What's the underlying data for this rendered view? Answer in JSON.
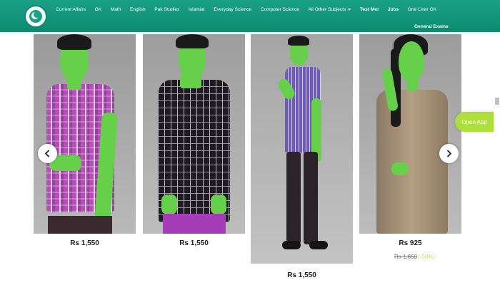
{
  "header": {
    "nav": [
      {
        "label": "Current Affairs",
        "bold": false
      },
      {
        "label": "GK",
        "bold": false
      },
      {
        "label": "Math",
        "bold": false
      },
      {
        "label": "English",
        "bold": false
      },
      {
        "label": "Pak Studies",
        "bold": false
      },
      {
        "label": "Islamiat",
        "bold": false
      },
      {
        "label": "Everyday Science",
        "bold": false
      },
      {
        "label": "Computer Science",
        "bold": false
      },
      {
        "label": "All Other Subjects",
        "bold": false
      },
      {
        "label": "Test Me!",
        "bold": true
      },
      {
        "label": "Jobs",
        "bold": true
      },
      {
        "label": "One Liner GK",
        "bold": false
      }
    ],
    "nav_second": "General Exams"
  },
  "products": [
    {
      "price": "Rs 1,550"
    },
    {
      "price": "Rs 1,550"
    },
    {
      "price": "Rs 1,550"
    },
    {
      "price": "Rs 925",
      "old_price": "Rs 1,850",
      "discount": "(-50%)"
    }
  ],
  "open_app_label": "Open App",
  "colors": {
    "header_bg": "#1aa286",
    "open_app_bg": "#aede3c",
    "skin": "#66d04a"
  }
}
